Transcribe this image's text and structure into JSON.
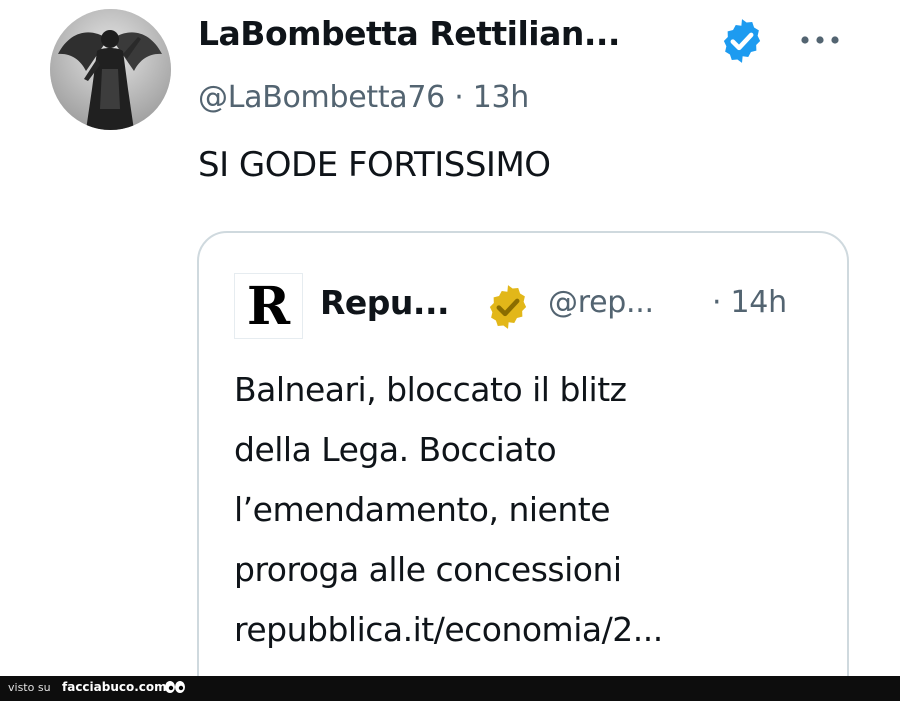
{
  "tweet": {
    "display_name": "LaBombetta Rettilian...",
    "handle": "@LaBombetta76",
    "separator": "·",
    "time": "13h",
    "text": "SI GODE FORTISSIMO",
    "verified_color": "#1d9bf0",
    "avatar_icon": "angel-statue-avatar",
    "more_icon": "more-dots-icon"
  },
  "quote": {
    "logo_letter": "R",
    "name": "Repu...",
    "handle": "@rep...",
    "separator": "·",
    "time": "14h",
    "badge_color": "#e2b719",
    "text_lines": [
      "Balneari, bloccato il blitz",
      "della Lega. Bocciato",
      "l’emendamento, niente",
      "proroga alle concessioni",
      "repubblica.it/economia/2..."
    ]
  },
  "watermark": {
    "prefix": "visto su",
    "site": "facciabuco.com",
    "icon": "eyes-icon"
  }
}
